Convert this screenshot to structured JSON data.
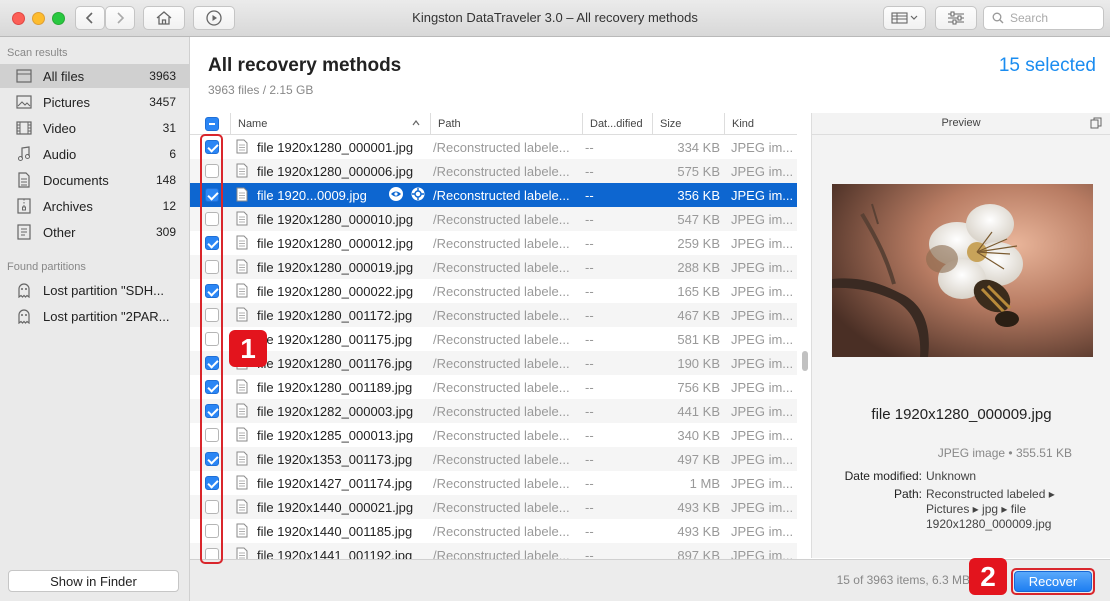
{
  "window": {
    "title": "Kingston DataTraveler 3.0 – All recovery methods"
  },
  "search": {
    "placeholder": "Search"
  },
  "sidebar": {
    "scan_results_label": "Scan results",
    "items": [
      {
        "label": "All files",
        "count": "3963",
        "icon": "all-files-icon"
      },
      {
        "label": "Pictures",
        "count": "3457",
        "icon": "picture-icon"
      },
      {
        "label": "Video",
        "count": "31",
        "icon": "video-icon"
      },
      {
        "label": "Audio",
        "count": "6",
        "icon": "audio-icon"
      },
      {
        "label": "Documents",
        "count": "148",
        "icon": "document-icon"
      },
      {
        "label": "Archives",
        "count": "12",
        "icon": "archive-icon"
      },
      {
        "label": "Other",
        "count": "309",
        "icon": "other-icon"
      }
    ],
    "found_partitions_label": "Found partitions",
    "partitions": [
      {
        "label": "Lost partition \"SDH..."
      },
      {
        "label": "Lost partition \"2PAR..."
      }
    ],
    "show_in_finder": "Show in Finder"
  },
  "main": {
    "title": "All recovery methods",
    "subtitle": "3963 files / 2.15 GB",
    "selected": "15 selected"
  },
  "table": {
    "columns": {
      "name": "Name",
      "path": "Path",
      "date": "Dat...dified",
      "size": "Size",
      "kind": "Kind"
    },
    "rows": [
      {
        "name": "file 1920x1280_000001.jpg",
        "path": "/Reconstructed labele...",
        "date": "--",
        "size": "334 KB",
        "kind": "JPEG im...",
        "checked": true
      },
      {
        "name": "file 1920x1280_000006.jpg",
        "path": "/Reconstructed labele...",
        "date": "--",
        "size": "575 KB",
        "kind": "JPEG im...",
        "checked": false
      },
      {
        "name": "file 1920...0009.jpg",
        "path": "/Reconstructed labele...",
        "date": "--",
        "size": "356 KB",
        "kind": "JPEG im...",
        "checked": true,
        "selected": true
      },
      {
        "name": "file 1920x1280_000010.jpg",
        "path": "/Reconstructed labele...",
        "date": "--",
        "size": "547 KB",
        "kind": "JPEG im...",
        "checked": false
      },
      {
        "name": "file 1920x1280_000012.jpg",
        "path": "/Reconstructed labele...",
        "date": "--",
        "size": "259 KB",
        "kind": "JPEG im...",
        "checked": true
      },
      {
        "name": "file 1920x1280_000019.jpg",
        "path": "/Reconstructed labele...",
        "date": "--",
        "size": "288 KB",
        "kind": "JPEG im...",
        "checked": false
      },
      {
        "name": "file 1920x1280_000022.jpg",
        "path": "/Reconstructed labele...",
        "date": "--",
        "size": "165 KB",
        "kind": "JPEG im...",
        "checked": true
      },
      {
        "name": "file 1920x1280_001172.jpg",
        "path": "/Reconstructed labele...",
        "date": "--",
        "size": "467 KB",
        "kind": "JPEG im...",
        "checked": false
      },
      {
        "name": "file 1920x1280_001175.jpg",
        "path": "/Reconstructed labele...",
        "date": "--",
        "size": "581 KB",
        "kind": "JPEG im...",
        "checked": false
      },
      {
        "name": "file 1920x1280_001176.jpg",
        "path": "/Reconstructed labele...",
        "date": "--",
        "size": "190 KB",
        "kind": "JPEG im...",
        "checked": true
      },
      {
        "name": "file 1920x1280_001189.jpg",
        "path": "/Reconstructed labele...",
        "date": "--",
        "size": "756 KB",
        "kind": "JPEG im...",
        "checked": true
      },
      {
        "name": "file 1920x1282_000003.jpg",
        "path": "/Reconstructed labele...",
        "date": "--",
        "size": "441 KB",
        "kind": "JPEG im...",
        "checked": true
      },
      {
        "name": "file 1920x1285_000013.jpg",
        "path": "/Reconstructed labele...",
        "date": "--",
        "size": "340 KB",
        "kind": "JPEG im...",
        "checked": false
      },
      {
        "name": "file 1920x1353_001173.jpg",
        "path": "/Reconstructed labele...",
        "date": "--",
        "size": "497 KB",
        "kind": "JPEG im...",
        "checked": true
      },
      {
        "name": "file 1920x1427_001174.jpg",
        "path": "/Reconstructed labele...",
        "date": "--",
        "size": "1 MB",
        "kind": "JPEG im...",
        "checked": true
      },
      {
        "name": "file 1920x1440_000021.jpg",
        "path": "/Reconstructed labele...",
        "date": "--",
        "size": "493 KB",
        "kind": "JPEG im...",
        "checked": false
      },
      {
        "name": "file 1920x1440_001185.jpg",
        "path": "/Reconstructed labele...",
        "date": "--",
        "size": "493 KB",
        "kind": "JPEG im...",
        "checked": false
      },
      {
        "name": "file 1920x1441_001192.jpg",
        "path": "/Reconstructed labele...",
        "date": "--",
        "size": "897 KB",
        "kind": "JPEG im...",
        "checked": false
      }
    ]
  },
  "preview": {
    "header": "Preview",
    "filename": "file 1920x1280_000009.jpg",
    "meta": "JPEG image • 355.51 KB",
    "date_label": "Date modified:",
    "date_value": "Unknown",
    "path_label": "Path:",
    "path_value": "Reconstructed labeled ▸ Pictures ▸ jpg ▸ file 1920x1280_000009.jpg"
  },
  "bottom": {
    "status": "15 of 3963 items, 6.3 MB",
    "recover": "Recover"
  },
  "annotations": {
    "badge1": "1",
    "badge2": "2"
  },
  "colors": {
    "accent": "#1a8cf0",
    "selection": "#0d66d0",
    "annotation": "#e3141d"
  }
}
